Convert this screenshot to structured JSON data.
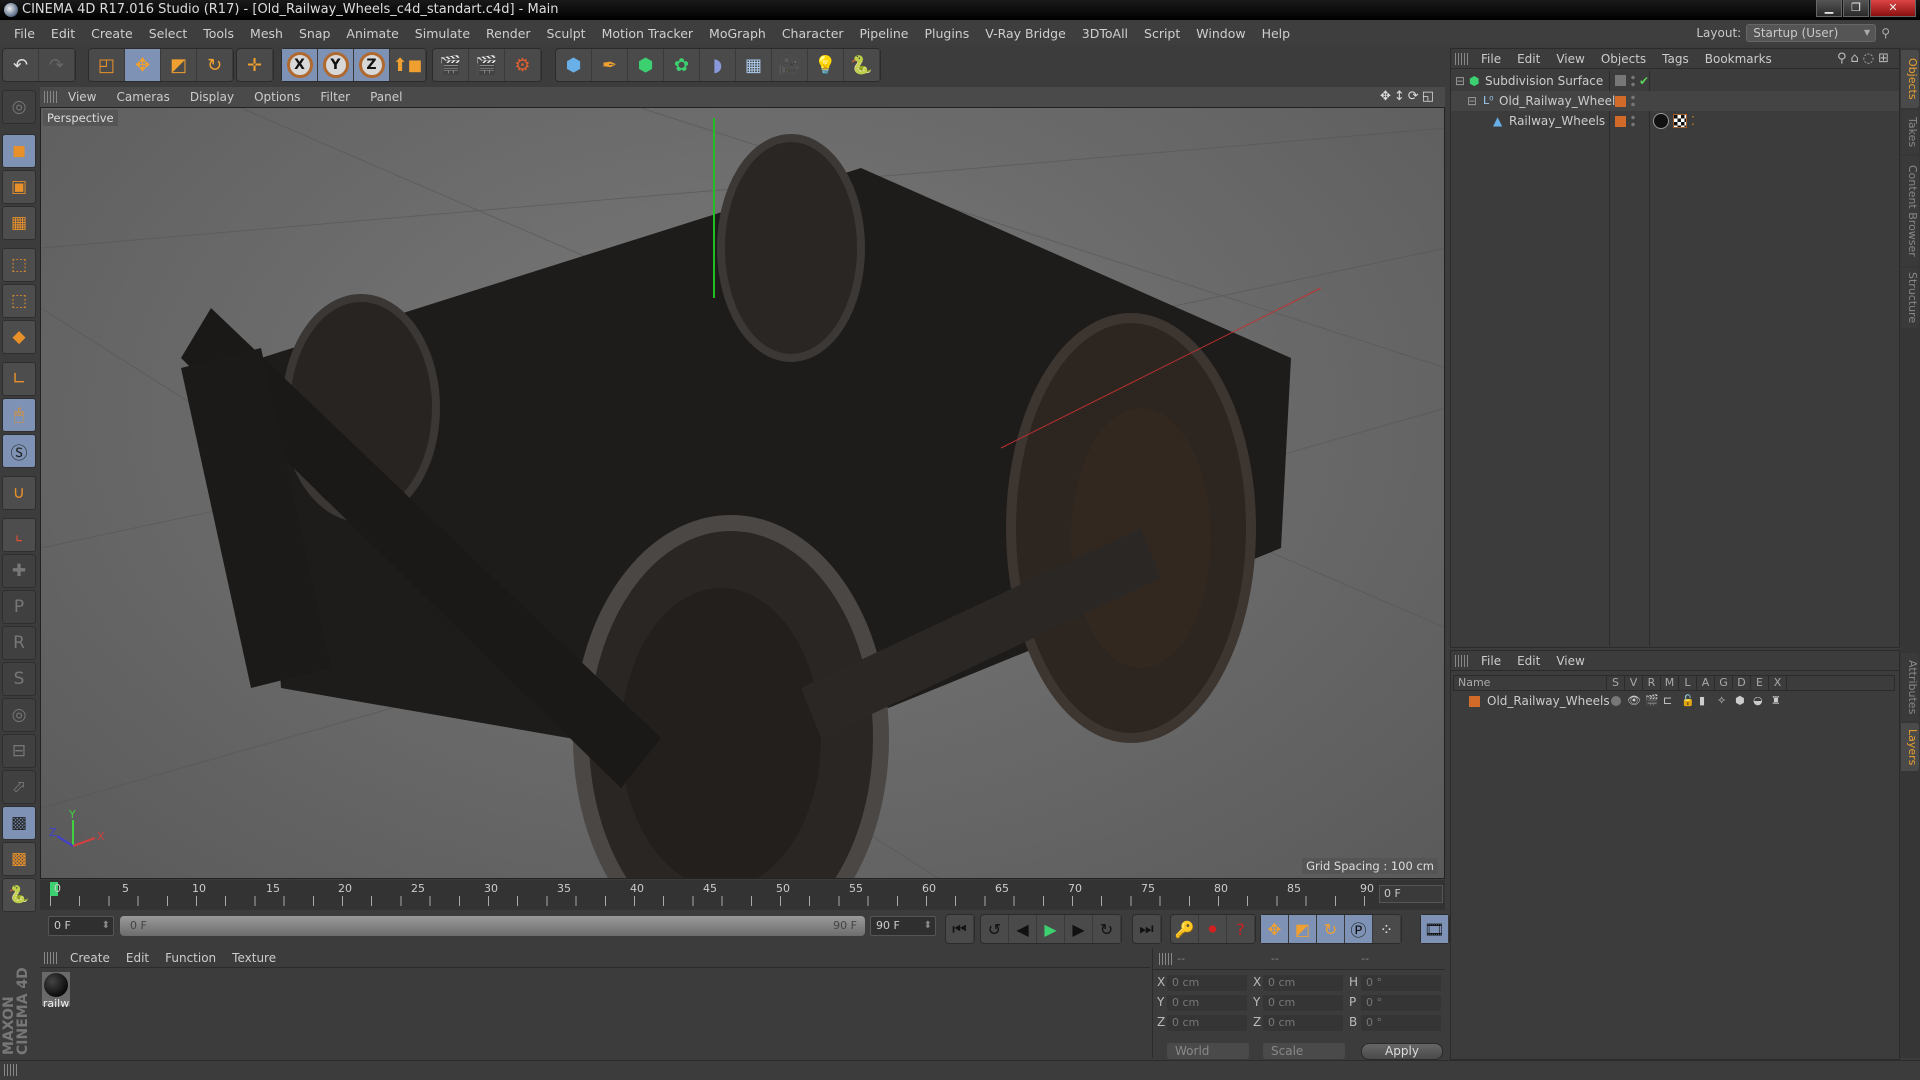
{
  "window": {
    "title": "CINEMA 4D R17.016 Studio (R17) - [Old_Railway_Wheels_c4d_standart.c4d] - Main",
    "controls": [
      "minimize",
      "restore",
      "close"
    ]
  },
  "menubar": [
    "File",
    "Edit",
    "Create",
    "Select",
    "Tools",
    "Mesh",
    "Snap",
    "Animate",
    "Simulate",
    "Render",
    "Sculpt",
    "Motion Tracker",
    "MoGraph",
    "Character",
    "Pipeline",
    "Plugins",
    "V-Ray Bridge",
    "3DToAll",
    "Script",
    "Window",
    "Help"
  ],
  "layout": {
    "label": "Layout:",
    "value": "Startup (User)"
  },
  "toolbar": {
    "undo": "undo-icon",
    "redo": "redo-icon",
    "tools": [
      "live-selection",
      "move",
      "scale",
      "rotate",
      "transform"
    ],
    "axes": [
      "X",
      "Y",
      "Z"
    ],
    "coord_system": "world-coordinates-icon",
    "render": [
      "render-view",
      "render-picture-viewer",
      "render-settings"
    ],
    "create": [
      "cube",
      "pen",
      "subdivision",
      "array",
      "deformer",
      "floor",
      "camera",
      "light",
      "python"
    ]
  },
  "left_tools": [
    "make-editable",
    "model-mode",
    "texture-mode",
    "workplane-mode",
    "points-mode",
    "edges-mode",
    "polygons-mode",
    "axis-mode",
    "tweak-mode",
    "solo-mode",
    "snap",
    "axis-locking",
    "xref-add",
    "xref-p",
    "xref-r",
    "xref-psr",
    "xref-target",
    "xref-param",
    "xref-pla",
    "workplane-lock",
    "workplane-rotate",
    "python"
  ],
  "viewport": {
    "menu": [
      "View",
      "Cameras",
      "Display",
      "Options",
      "Filter",
      "Panel"
    ],
    "camera_label": "Perspective",
    "grid_spacing": "Grid Spacing : 100 cm",
    "axis_labels": [
      "X",
      "Y",
      "Z"
    ]
  },
  "timeline": {
    "ticks": [
      "0",
      "5",
      "10",
      "15",
      "20",
      "25",
      "30",
      "35",
      "40",
      "45",
      "50",
      "55",
      "60",
      "65",
      "70",
      "75",
      "80",
      "85",
      "90"
    ],
    "current_frame": "0 F",
    "start_field": "0 F",
    "range_start": "0 F",
    "range_end": "90 F",
    "end_field": "90 F"
  },
  "material_panel": {
    "menu": [
      "Create",
      "Edit",
      "Function",
      "Texture"
    ],
    "materials": [
      {
        "name": "railw"
      }
    ]
  },
  "branding": "MAXON CINEMA 4D",
  "coordinates": {
    "headers": [
      "--",
      "--",
      "--"
    ],
    "position": {
      "X": "0 cm",
      "Y": "0 cm",
      "Z": "0 cm"
    },
    "size": {
      "X": "0 cm",
      "Y": "0 cm",
      "Z": "0 cm"
    },
    "rotation": {
      "H": "0 °",
      "P": "0 °",
      "B": "0 °"
    },
    "mode": "World",
    "size_mode": "Scale",
    "apply": "Apply"
  },
  "object_manager": {
    "menu": [
      "File",
      "Edit",
      "View",
      "Objects",
      "Tags",
      "Bookmarks"
    ],
    "objects": [
      {
        "name": "Subdivision Surface",
        "depth": 0,
        "icon": "subdivision-icon"
      },
      {
        "name": "Old_Railway_Wheels",
        "depth": 1,
        "icon": "null-icon"
      },
      {
        "name": "Railway_Wheels",
        "depth": 2,
        "icon": "polygon-icon"
      }
    ]
  },
  "layer_manager": {
    "menu": [
      "File",
      "Edit",
      "View"
    ],
    "columns": [
      "Name",
      "S",
      "V",
      "R",
      "M",
      "L",
      "A",
      "G",
      "D",
      "E",
      "X"
    ],
    "layers": [
      {
        "name": "Old_Railway_Wheels",
        "color": "#d26a2a"
      }
    ]
  },
  "side_tabs": {
    "top": [
      "Objects",
      "Takes",
      "Content Browser",
      "Structure"
    ],
    "bottom": [
      "Attributes",
      "Layers"
    ]
  },
  "colors": {
    "accent": "#e8902a",
    "active_tool": "#7d92b4",
    "layer": "#d26a2a",
    "play": "#3cd070"
  }
}
